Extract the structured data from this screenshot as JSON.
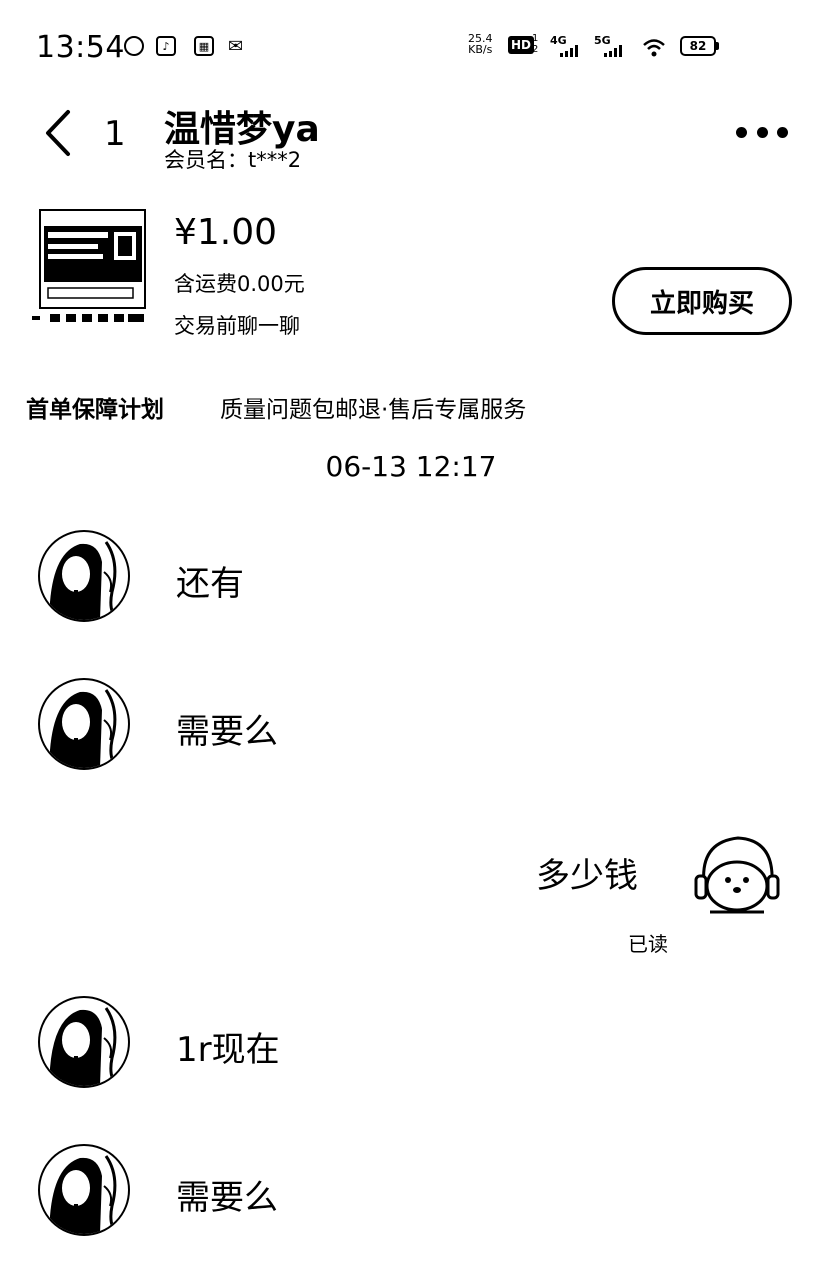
{
  "status_bar": {
    "time": "13:54",
    "net_speed_value": "25.4",
    "net_speed_unit": "KB/s",
    "hd_badge": "HD",
    "sim_numbers": "1\n2",
    "network_4g": "4G",
    "network_5g": "5G",
    "battery": "82",
    "app_icons": [
      "maps-icon",
      "tiktok-icon",
      "gallery-icon",
      "wechat-icon"
    ]
  },
  "header": {
    "unread_count": "1",
    "contact_name": "温惜梦ya",
    "member_name": "会员名：t***2"
  },
  "product": {
    "price": "¥1.00",
    "shipping": "含运费0.00元",
    "note": "交易前聊一聊",
    "buy_button": "立即购买"
  },
  "guarantee": {
    "title": "首单保障计划",
    "description": "质量问题包邮退·售后专属服务"
  },
  "chat": {
    "timestamp": "06-13 12:17",
    "messages": [
      {
        "from": "other",
        "text": "还有"
      },
      {
        "from": "other",
        "text": "需要么"
      },
      {
        "from": "self",
        "text": "多少钱",
        "status": "已读"
      },
      {
        "from": "other",
        "text": "1r现在"
      },
      {
        "from": "other",
        "text": "需要么"
      }
    ]
  }
}
